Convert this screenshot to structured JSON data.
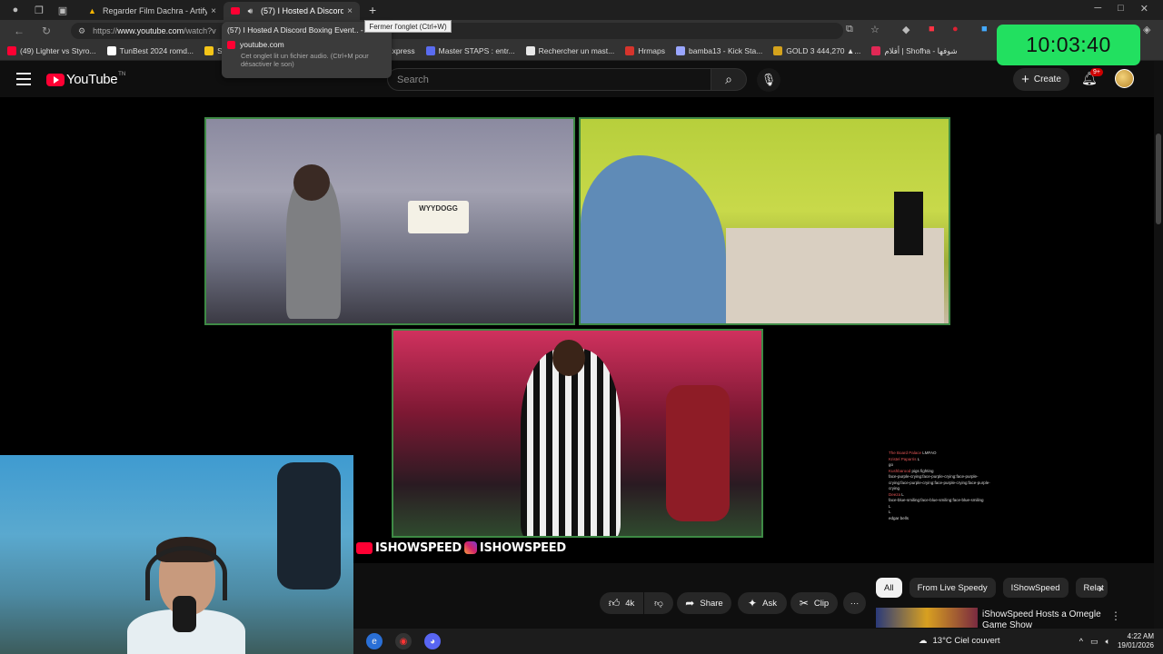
{
  "browser": {
    "tabs": [
      {
        "title": "Regarder Film Dachra - Artify",
        "close": "×"
      },
      {
        "title": "(57) I Hosted A Discord Boxing Event..",
        "close": "×"
      }
    ],
    "new_tab": "+",
    "window_controls": [
      "─",
      "□",
      "✕"
    ],
    "url_prefix": "https://",
    "url_host": "www.youtube.com",
    "url_rest": "/watch?v",
    "bookmarks": [
      {
        "label": "(49) Lighter vs Styro...",
        "color": "#ff0033"
      },
      {
        "label": "TunBest 2024 romd...",
        "color": "#ffffff"
      },
      {
        "label": "Strea",
        "color": "#f5c518"
      },
      {
        "label": "Stripe Express",
        "color": "#635bff"
      },
      {
        "label": "Master STAPS : entr...",
        "color": "#5a6cf0"
      },
      {
        "label": "Rechercher un mast...",
        "color": "#e8e8e8"
      },
      {
        "label": "Hrmaps",
        "color": "#d6342c"
      },
      {
        "label": "bamba13 - Kick Sta...",
        "color": "#9aa6ff"
      },
      {
        "label": "GOLD 3 444,270 ▲...",
        "color": "#d4a21c"
      },
      {
        "label": "أفلام | Shofha - شوفها",
        "color": "#e02855"
      }
    ],
    "hover_card": {
      "title": "(57) I Hosted A Discord Boxing Event.. - You",
      "site": "youtube.com",
      "note": "Cet onglet lit un fichier audio. (Ctrl+M pour désactiver le son)"
    },
    "tooltip": "Fermer l'onglet (Ctrl+W)"
  },
  "clock": "10:03:40",
  "youtube": {
    "logo": "YouTube",
    "country": "TN",
    "search_placeholder": "Search",
    "create_label": "Create",
    "notif_count": "9+"
  },
  "video": {
    "sign_text": "WYYDOGG",
    "watermark_1": "ISHOWSPEED",
    "watermark_2": "ISHOWSPEED",
    "chat": [
      {
        "user": "The Board Palace",
        "msg": "LMFAO"
      },
      {
        "user": "Kristel Paparris",
        "msg": "L"
      },
      {
        "user": "",
        "msg": "go"
      },
      {
        "user": "Kushbarood",
        "msg": "pigs fighting"
      },
      {
        "user": "",
        "msg": "face-purple-crying:face-purple-crying:face-purple-crying:face-purple-crying:face-purple-crying:face-purple-crying"
      },
      {
        "user": "Deeza",
        "msg": "L"
      },
      {
        "user": "",
        "msg": "face-blue-smiling:face-blue-smiling:face-blue-smiling"
      },
      {
        "user": "",
        "msg": "L"
      },
      {
        "user": "",
        "msg": "L"
      },
      {
        "user": "",
        "msg": "edgar bells"
      }
    ]
  },
  "actions": {
    "like": "4k",
    "share": "Share",
    "ask": "Ask",
    "clip": "Clip",
    "more": "···"
  },
  "chips": [
    "All",
    "From Live Speedy",
    "IShowSpeed",
    "Relat"
  ],
  "recommendation": {
    "title": "iShowSpeed Hosts a Omegle Game Show",
    "more": "⋮"
  },
  "taskbar": {
    "weather": "13°C  Ciel couvert",
    "time": "4:22 AM",
    "date": "19/01/2026"
  },
  "colors": {
    "clock_bg": "#22e060",
    "youtube_red": "#ff0033",
    "frame_green": "#3e8a45"
  }
}
